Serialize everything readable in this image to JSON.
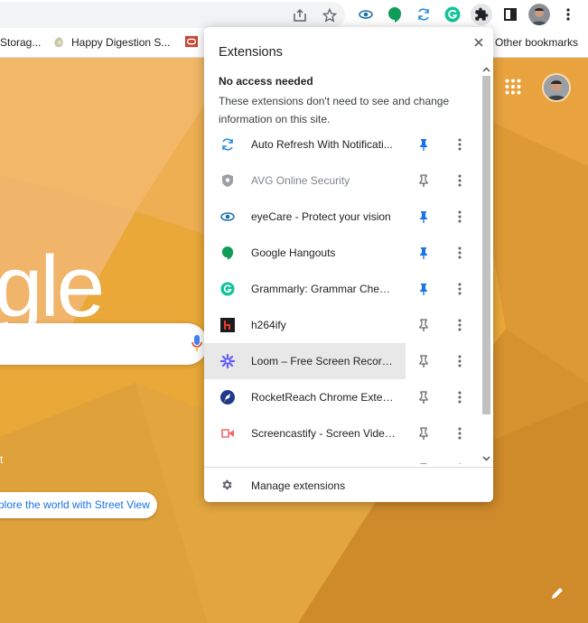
{
  "toolbar": {
    "icons": [
      "share-icon",
      "bookmark-star-icon",
      "eyecare-icon",
      "hangouts-icon",
      "auto-refresh-icon",
      "grammarly-icon",
      "extensions-puzzle-icon",
      "side-panel-icon",
      "profile-avatar",
      "chrome-menu-icon"
    ]
  },
  "bookmarks": {
    "item1": "Storag...",
    "item2": "Happy Digestion S...",
    "other": "Other bookmarks"
  },
  "ntp": {
    "logo_text": "gle",
    "side_text": "t",
    "street_view": "plore the world with Street View"
  },
  "extensions": {
    "title": "Extensions",
    "section_heading": "No access needed",
    "section_desc": "These extensions don't need to see and change information on this site.",
    "items": [
      {
        "name": "Auto Refresh With Notificati...",
        "pinned": true
      },
      {
        "name": "AVG Online Security",
        "pinned": false,
        "disabled": true
      },
      {
        "name": "eyeCare - Protect your vision",
        "pinned": true
      },
      {
        "name": "Google Hangouts",
        "pinned": true
      },
      {
        "name": "Grammarly: Grammar Check...",
        "pinned": true
      },
      {
        "name": "h264ify",
        "pinned": false
      },
      {
        "name": "Loom – Free Screen Record...",
        "pinned": false
      },
      {
        "name": "RocketReach Chrome Extens...",
        "pinned": false
      },
      {
        "name": "Screencastify - Screen Video...",
        "pinned": false
      }
    ],
    "manage_label": "Manage extensions"
  },
  "colors": {
    "pin_active": "#1a73e8",
    "pin_inactive": "#5f6368",
    "background_orange": "#e9a233"
  }
}
